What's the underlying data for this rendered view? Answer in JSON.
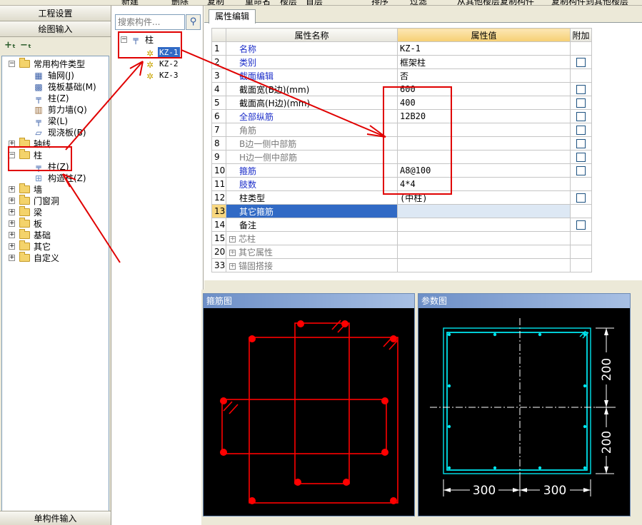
{
  "toolbar": {
    "new": "新建",
    "delete": "删除",
    "copy": "复制",
    "rename": "重命名",
    "floor_label": "楼层",
    "floor_value": "首层",
    "sort": "排序",
    "filter": "过滤",
    "copy_from_floor": "从其他楼层复制构件",
    "copy_to_floor": "复制构件到其他楼层"
  },
  "nav": {
    "project_settings": "工程设置",
    "drawing_input": "绘图输入",
    "single_component_input": "单构件输入",
    "tree": [
      {
        "label": "常用构件类型",
        "type": "folder",
        "expanded": true
      },
      {
        "label": "轴网(J)",
        "type": "item",
        "icon": "grid-icon"
      },
      {
        "label": "筏板基础(M)",
        "type": "item",
        "icon": "raft-foundation-icon"
      },
      {
        "label": "柱(Z)",
        "type": "item",
        "icon": "column-icon"
      },
      {
        "label": "剪力墙(Q)",
        "type": "item",
        "icon": "shear-wall-icon"
      },
      {
        "label": "梁(L)",
        "type": "item",
        "icon": "beam-icon"
      },
      {
        "label": "现浇板(B)",
        "type": "item",
        "icon": "slab-icon"
      },
      {
        "label": "轴线",
        "type": "folder",
        "expanded": false
      },
      {
        "label": "柱",
        "type": "folder",
        "expanded": true
      },
      {
        "label": "柱(Z)",
        "type": "item",
        "icon": "column-icon"
      },
      {
        "label": "构造柱(Z)",
        "type": "item",
        "icon": "construction-column-icon"
      },
      {
        "label": "墙",
        "type": "folder",
        "expanded": false
      },
      {
        "label": "门窗洞",
        "type": "folder",
        "expanded": false
      },
      {
        "label": "梁",
        "type": "folder",
        "expanded": false
      },
      {
        "label": "板",
        "type": "folder",
        "expanded": false
      },
      {
        "label": "基础",
        "type": "folder",
        "expanded": false
      },
      {
        "label": "其它",
        "type": "folder",
        "expanded": false
      },
      {
        "label": "自定义",
        "type": "folder",
        "expanded": false
      }
    ]
  },
  "components": {
    "search_placeholder": "搜索构件...",
    "group_label": "柱",
    "items": [
      "KZ-1",
      "KZ-2",
      "KZ-3"
    ],
    "selected": "KZ-1"
  },
  "properties": {
    "tab_label": "属性编辑",
    "col_name": "属性名称",
    "col_value": "属性值",
    "col_extra": "附加",
    "rows": [
      {
        "num": "1",
        "name": "名称",
        "value": "KZ-1",
        "style": "blue",
        "checkbox": false
      },
      {
        "num": "2",
        "name": "类别",
        "value": "框架柱",
        "style": "blue",
        "checkbox": true
      },
      {
        "num": "3",
        "name": "截面编辑",
        "value": "否",
        "style": "blue",
        "checkbox": false
      },
      {
        "num": "4",
        "name": "截面宽(B边)(mm)",
        "value": "600",
        "style": "black",
        "checkbox": true
      },
      {
        "num": "5",
        "name": "截面高(H边)(mm)",
        "value": "400",
        "style": "black",
        "checkbox": true
      },
      {
        "num": "6",
        "name": "全部纵筋",
        "value": "12B20",
        "style": "blue",
        "checkbox": true
      },
      {
        "num": "7",
        "name": "角筋",
        "value": "",
        "style": "gray",
        "checkbox": true
      },
      {
        "num": "8",
        "name": "B边一侧中部筋",
        "value": "",
        "style": "gray",
        "checkbox": true
      },
      {
        "num": "9",
        "name": "H边一侧中部筋",
        "value": "",
        "style": "gray",
        "checkbox": true
      },
      {
        "num": "10",
        "name": "箍筋",
        "value": "A8@100",
        "style": "blue",
        "checkbox": true
      },
      {
        "num": "11",
        "name": "肢数",
        "value": "4*4",
        "style": "blue",
        "checkbox": false
      },
      {
        "num": "12",
        "name": "柱类型",
        "value": "(中柱)",
        "style": "black",
        "checkbox": true
      },
      {
        "num": "13",
        "name": "其它箍筋",
        "value": "",
        "style": "selected",
        "checkbox": false
      },
      {
        "num": "14",
        "name": "备注",
        "value": "",
        "style": "black",
        "checkbox": true
      },
      {
        "num": "15",
        "name": "芯柱",
        "value": "",
        "style": "group",
        "checkbox": false
      },
      {
        "num": "20",
        "name": "其它属性",
        "value": "",
        "style": "group",
        "checkbox": false
      },
      {
        "num": "33",
        "name": "锚固搭接",
        "value": "",
        "style": "group",
        "checkbox": false
      }
    ]
  },
  "stirrup_view": {
    "title": "箍筋图"
  },
  "param_view": {
    "title": "参数图",
    "dim_h1": "200",
    "dim_h2": "200",
    "dim_w1": "300",
    "dim_w2": "300"
  },
  "colors": {
    "annotation": "#e00000",
    "rebar": "#ff0000",
    "cyan": "#00e5ee",
    "selection": "#316ac5"
  }
}
